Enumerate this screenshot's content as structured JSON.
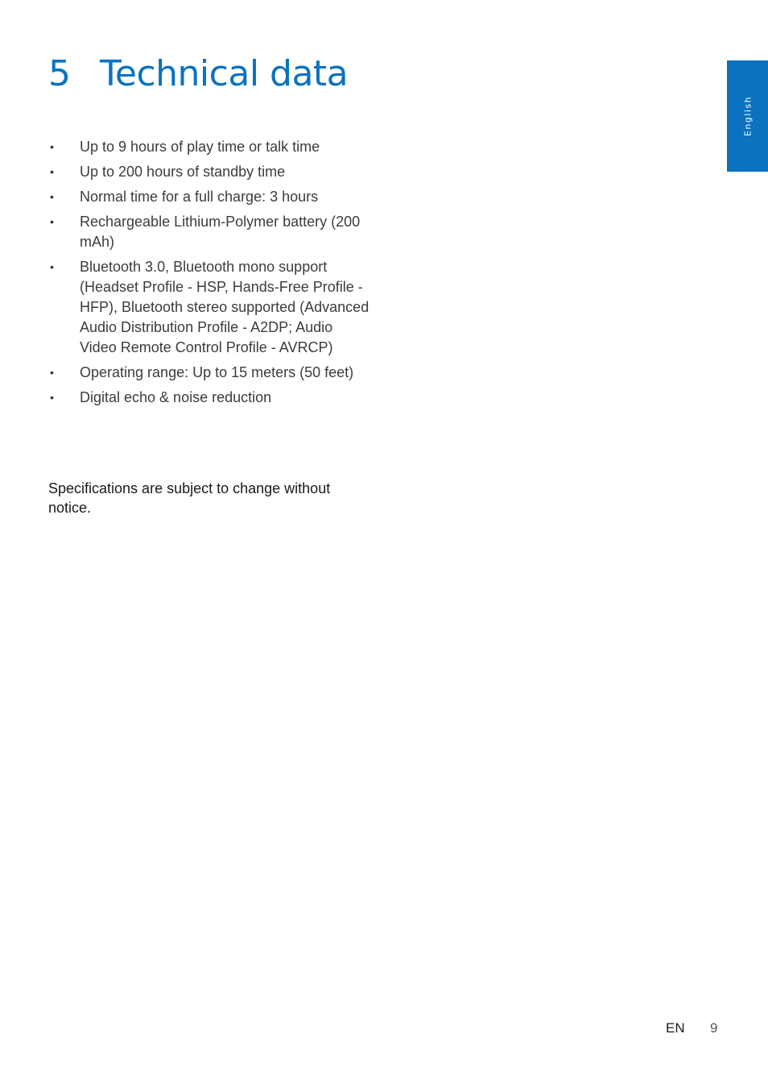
{
  "heading": {
    "number": "5",
    "title": "Technical data"
  },
  "language_tab": "English",
  "specs": [
    "Up to 9 hours of play time or talk time",
    "Up to 200 hours of standby time",
    "Normal time for a full charge: 3 hours",
    "Rechargeable Lithium-Polymer battery (200 mAh)",
    "Bluetooth 3.0, Bluetooth mono support (Headset Profile - HSP, Hands-Free Profile - HFP), Bluetooth stereo supported (Advanced Audio Distribution Profile - A2DP; Audio Video Remote Control Profile - AVRCP)",
    "Operating range: Up to 15 meters (50 feet)",
    "Digital echo & noise reduction"
  ],
  "bullet_glyph": "•",
  "note": "Specifications are subject to change without notice.",
  "footer": {
    "language": "EN",
    "page_number": "9"
  },
  "colors": {
    "accent": "#0a72c1"
  }
}
